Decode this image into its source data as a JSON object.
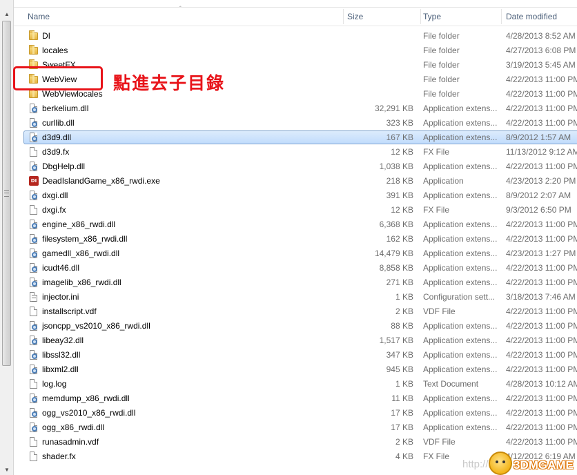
{
  "columns": {
    "name": "Name",
    "size": "Size",
    "type": "Type",
    "date": "Date modified"
  },
  "rows": [
    {
      "name": "DI",
      "size": "",
      "type": "File folder",
      "date": "4/28/2013 8:52 AM",
      "icon": "folder-icon"
    },
    {
      "name": "locales",
      "size": "",
      "type": "File folder",
      "date": "4/27/2013 6:08 PM",
      "icon": "folder-icon"
    },
    {
      "name": "SweetFX",
      "size": "",
      "type": "File folder",
      "date": "3/19/2013 5:45 AM",
      "icon": "folder-icon"
    },
    {
      "name": "WebView",
      "size": "",
      "type": "File folder",
      "date": "4/22/2013 11:00 PM",
      "icon": "folder-icon"
    },
    {
      "name": "WebViewlocales",
      "size": "",
      "type": "File folder",
      "date": "4/22/2013 11:00 PM",
      "icon": "folder-icon"
    },
    {
      "name": "berkelium.dll",
      "size": "32,291 KB",
      "type": "Application extens...",
      "date": "4/22/2013 11:00 PM",
      "icon": "dll-icon"
    },
    {
      "name": "curllib.dll",
      "size": "323 KB",
      "type": "Application extens...",
      "date": "4/22/2013 11:00 PM",
      "icon": "dll-icon"
    },
    {
      "name": "d3d9.dll",
      "size": "167 KB",
      "type": "Application extens...",
      "date": "8/9/2012 1:57 AM",
      "icon": "dll-icon",
      "selected": true
    },
    {
      "name": "d3d9.fx",
      "size": "12 KB",
      "type": "FX File",
      "date": "11/13/2012 9:12 AM",
      "icon": "file-icon"
    },
    {
      "name": "DbgHelp.dll",
      "size": "1,038 KB",
      "type": "Application extens...",
      "date": "4/22/2013 11:00 PM",
      "icon": "dll-icon"
    },
    {
      "name": "DeadIslandGame_x86_rwdi.exe",
      "size": "218 KB",
      "type": "Application",
      "date": "4/23/2013 2:20 PM",
      "icon": "exe-icon"
    },
    {
      "name": "dxgi.dll",
      "size": "391 KB",
      "type": "Application extens...",
      "date": "8/9/2012 2:07 AM",
      "icon": "dll-icon"
    },
    {
      "name": "dxgi.fx",
      "size": "12 KB",
      "type": "FX File",
      "date": "9/3/2012 6:50 PM",
      "icon": "file-icon"
    },
    {
      "name": "engine_x86_rwdi.dll",
      "size": "6,368 KB",
      "type": "Application extens...",
      "date": "4/22/2013 11:00 PM",
      "icon": "dll-icon"
    },
    {
      "name": "filesystem_x86_rwdi.dll",
      "size": "162 KB",
      "type": "Application extens...",
      "date": "4/22/2013 11:00 PM",
      "icon": "dll-icon"
    },
    {
      "name": "gamedll_x86_rwdi.dll",
      "size": "14,479 KB",
      "type": "Application extens...",
      "date": "4/23/2013 1:27 PM",
      "icon": "dll-icon"
    },
    {
      "name": "icudt46.dll",
      "size": "8,858 KB",
      "type": "Application extens...",
      "date": "4/22/2013 11:00 PM",
      "icon": "dll-icon"
    },
    {
      "name": "imagelib_x86_rwdi.dll",
      "size": "271 KB",
      "type": "Application extens...",
      "date": "4/22/2013 11:00 PM",
      "icon": "dll-icon"
    },
    {
      "name": "injector.ini",
      "size": "1 KB",
      "type": "Configuration sett...",
      "date": "3/18/2013 7:46 AM",
      "icon": "ini-icon"
    },
    {
      "name": "installscript.vdf",
      "size": "2 KB",
      "type": "VDF File",
      "date": "4/22/2013 11:00 PM",
      "icon": "file-icon"
    },
    {
      "name": "jsoncpp_vs2010_x86_rwdi.dll",
      "size": "88 KB",
      "type": "Application extens...",
      "date": "4/22/2013 11:00 PM",
      "icon": "dll-icon"
    },
    {
      "name": "libeay32.dll",
      "size": "1,517 KB",
      "type": "Application extens...",
      "date": "4/22/2013 11:00 PM",
      "icon": "dll-icon"
    },
    {
      "name": "libssl32.dll",
      "size": "347 KB",
      "type": "Application extens...",
      "date": "4/22/2013 11:00 PM",
      "icon": "dll-icon"
    },
    {
      "name": "libxml2.dll",
      "size": "945 KB",
      "type": "Application extens...",
      "date": "4/22/2013 11:00 PM",
      "icon": "dll-icon"
    },
    {
      "name": "log.log",
      "size": "1 KB",
      "type": "Text Document",
      "date": "4/28/2013 10:12 AM",
      "icon": "file-icon"
    },
    {
      "name": "memdump_x86_rwdi.dll",
      "size": "11 KB",
      "type": "Application extens...",
      "date": "4/22/2013 11:00 PM",
      "icon": "dll-icon"
    },
    {
      "name": "ogg_vs2010_x86_rwdi.dll",
      "size": "17 KB",
      "type": "Application extens...",
      "date": "4/22/2013 11:00 PM",
      "icon": "dll-icon"
    },
    {
      "name": "ogg_x86_rwdi.dll",
      "size": "17 KB",
      "type": "Application extens...",
      "date": "4/22/2013 11:00 PM",
      "icon": "dll-icon"
    },
    {
      "name": "runasadmin.vdf",
      "size": "2 KB",
      "type": "VDF File",
      "date": "4/22/2013 11:00 PM",
      "icon": "file-icon"
    },
    {
      "name": "shader.fx",
      "size": "4 KB",
      "type": "FX File",
      "date": "4/12/2012 6:19 AM",
      "icon": "file-icon"
    }
  ],
  "annotation": {
    "text": "點進去子目錄",
    "target": "WebView",
    "color": "#e8141a"
  },
  "watermark": {
    "text": "http://bbs.",
    "brand": "3DMGAME"
  },
  "colors": {
    "selection": "#cce4fc",
    "header_text": "#4c607a",
    "annotation": "#e8141a"
  }
}
